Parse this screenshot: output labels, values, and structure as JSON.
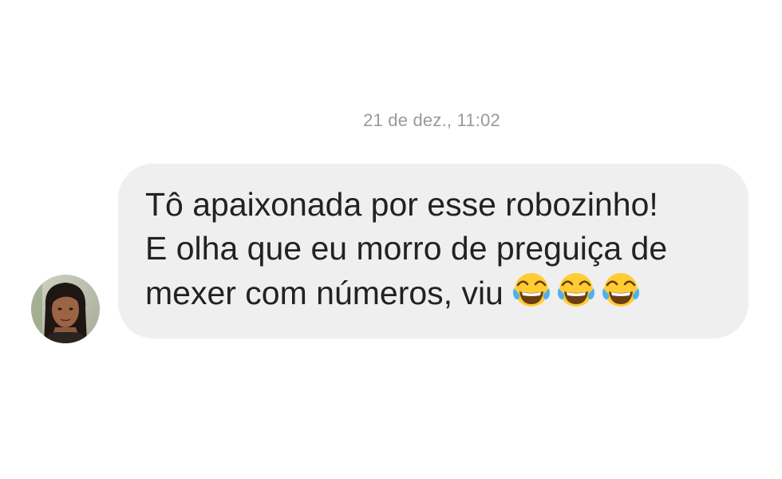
{
  "conversation": {
    "timestamp": "21 de dez., 11:02",
    "message": {
      "lines": [
        "Tô apaixonada por esse robozinho!",
        "E olha que eu morro de preguiça de",
        "mexer com números, viu"
      ],
      "emojis": [
        "face-with-tears-of-joy",
        "face-with-tears-of-joy",
        "face-with-tears-of-joy"
      ],
      "bubble_color": "#efefef",
      "text_color": "#222222"
    },
    "sender": {
      "avatar_icon": "user-avatar-photo"
    }
  }
}
